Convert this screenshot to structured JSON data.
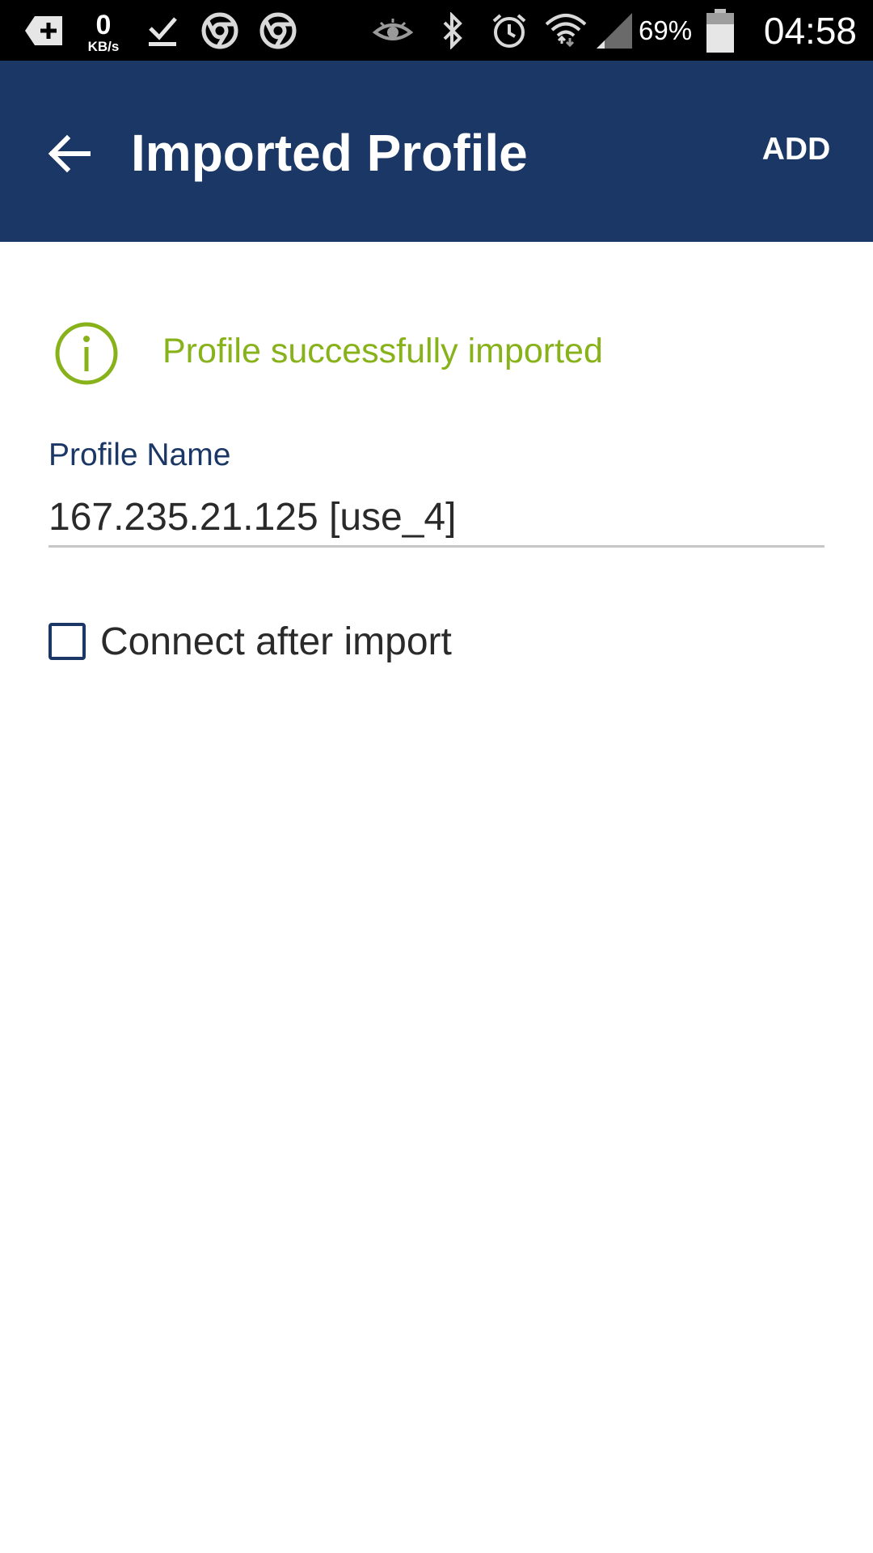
{
  "status_bar": {
    "icons": [
      "add-notification-icon",
      "download-done-icon",
      "chrome-icon",
      "chrome-icon",
      "eye-icon",
      "bluetooth-icon",
      "alarm-icon",
      "wifi-icon",
      "signal-icon",
      "battery-icon"
    ],
    "net_speed_value": "0",
    "net_speed_unit": "KB/s",
    "battery_percent": "69%",
    "time": "04:58"
  },
  "app_bar": {
    "title": "Imported Profile",
    "action_label": "ADD",
    "background_color": "#1b3765"
  },
  "banner": {
    "message": "Profile successfully imported",
    "icon": "info-icon",
    "color": "#87b21a"
  },
  "profile_name": {
    "label": "Profile Name",
    "value": "167.235.21.125 [use_4]"
  },
  "connect_after_import": {
    "label": "Connect after import",
    "checked": false
  }
}
